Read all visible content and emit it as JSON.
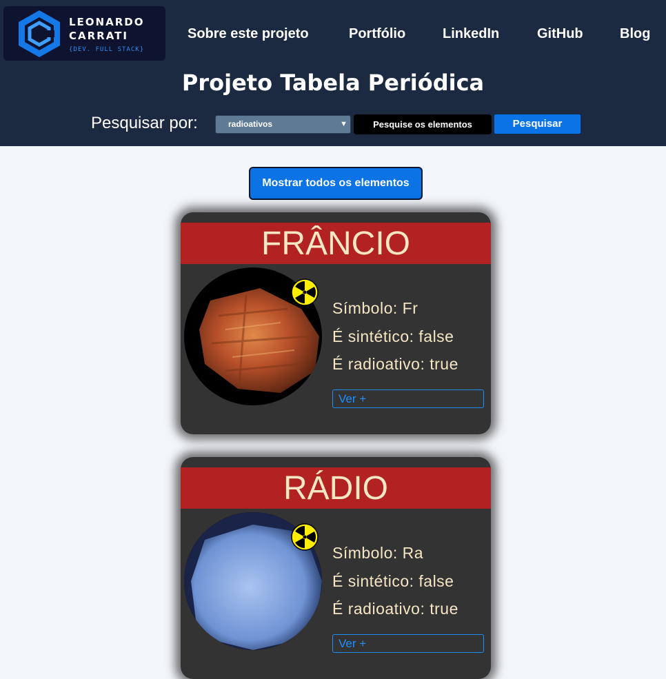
{
  "header": {
    "logo": {
      "line1": "LEONARDO",
      "line2": "CARRATI",
      "tagline": "{DEV. FULL STACK}"
    },
    "nav": [
      "Sobre este projeto",
      "Portfólio",
      "LinkedIn",
      "GitHub",
      "Blog"
    ],
    "title": "Projeto Tabela Periódica"
  },
  "search": {
    "label": "Pesquisar por:",
    "filter_selected": "radioativos",
    "input_value": "Pesquise os elementos",
    "button": "Pesquisar"
  },
  "show_all_button": "Mostrar todos os elementos",
  "elements": [
    {
      "name": "FRÂNCIO",
      "symbol_line": "Símbolo: Fr",
      "synthetic_line": "É sintético: false",
      "radioactive_line": "É radioativo: true",
      "more": "Ver +"
    },
    {
      "name": "RÁDIO",
      "symbol_line": "Símbolo: Ra",
      "synthetic_line": "É sintético: false",
      "radioactive_line": "É radioativo: true",
      "more": "Ver +"
    }
  ],
  "icons": {
    "radioactive": "radiation-icon",
    "dropdown": "chevron-down-icon",
    "logo": "hexagon-logo-icon"
  },
  "colors": {
    "header_bg": "#1b2a40",
    "accent_blue": "#0b73e6",
    "card_bg": "#333333",
    "card_title_bg": "#b22222",
    "card_text": "#f5e6c4",
    "link": "#1e90ff"
  }
}
